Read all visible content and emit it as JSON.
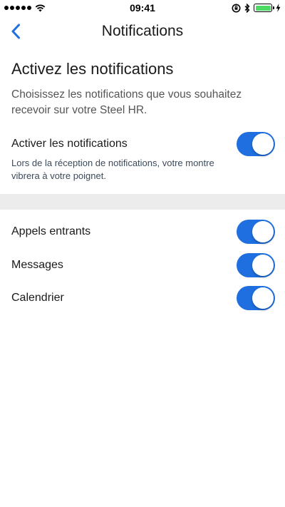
{
  "status_bar": {
    "time": "09:41"
  },
  "nav": {
    "title": "Notifications"
  },
  "intro": {
    "heading": "Activez les notifications",
    "description": "Choisissez les notifications que vous souhaitez recevoir sur votre Steel HR."
  },
  "main_toggle": {
    "label": "Activer les notifications",
    "help": "Lors de la réception de notifications, votre montre vibrera à votre poignet.",
    "enabled": true
  },
  "items": [
    {
      "label": "Appels entrants",
      "enabled": true
    },
    {
      "label": "Messages",
      "enabled": true
    },
    {
      "label": "Calendrier",
      "enabled": true
    }
  ],
  "colors": {
    "accent": "#1f6fe0",
    "band": "#ececec",
    "battery": "#4cd964"
  }
}
